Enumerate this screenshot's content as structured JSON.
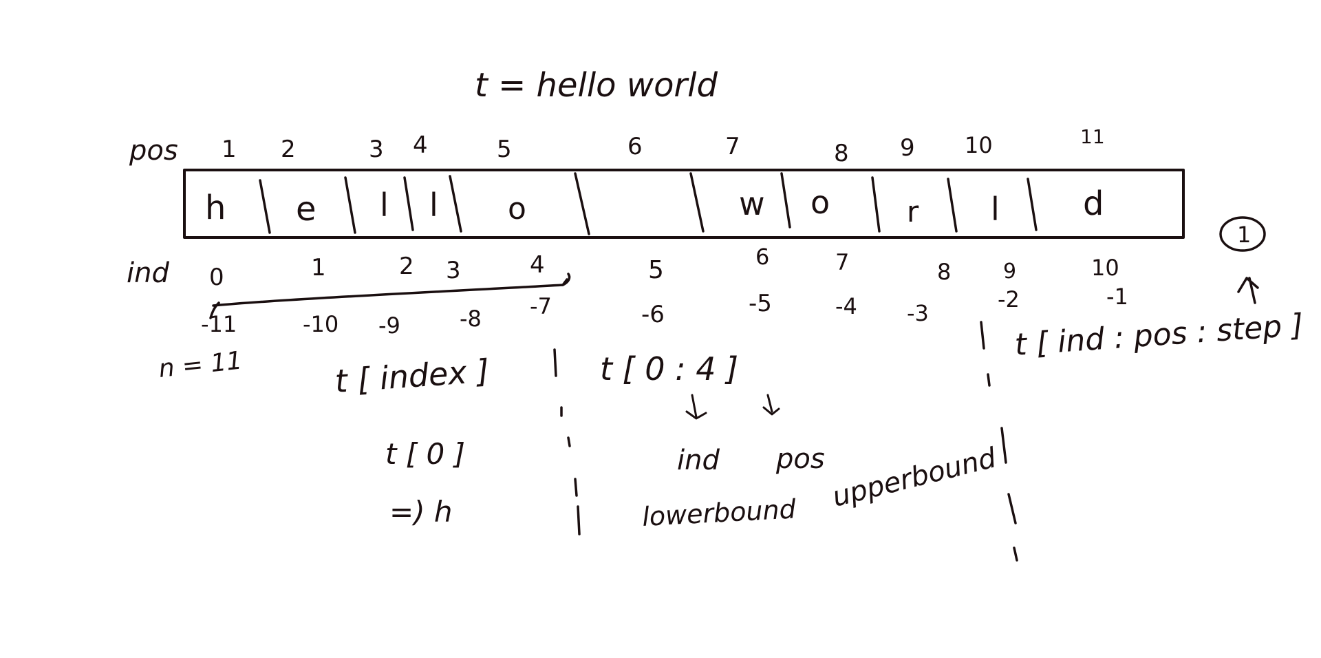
{
  "title": "t = hello world",
  "pos_label": "pos",
  "pos_values": [
    "1",
    "2",
    "3",
    "4",
    "5",
    "6",
    "7",
    "8",
    "9",
    "10",
    "11"
  ],
  "chars": [
    "h",
    "e",
    "l",
    "l",
    "o",
    "",
    "w",
    "o",
    "r",
    "l",
    "d"
  ],
  "ind_label": "ind",
  "ind_values": [
    "0",
    "1",
    "2",
    "3",
    "4",
    "5",
    "6",
    "7",
    "8",
    "9",
    "10"
  ],
  "neg_values": [
    "-11",
    "-10",
    "-9",
    "-8",
    "-7",
    "-6",
    "-5",
    "-4",
    "-3",
    "-2",
    "-1"
  ],
  "n_note": "n = 11",
  "index_col": {
    "syntax": "t [ index ]",
    "example": "t [ 0 ]",
    "result": "=) h"
  },
  "slice_col": {
    "syntax": "t [ 0 : 4 ]",
    "lower_term": "ind",
    "upper_term": "pos",
    "lower_label": "lowerbound",
    "upper_label": "upperbound"
  },
  "step_col": {
    "syntax": "t [ ind : pos : step ]",
    "step_marker": "1"
  }
}
